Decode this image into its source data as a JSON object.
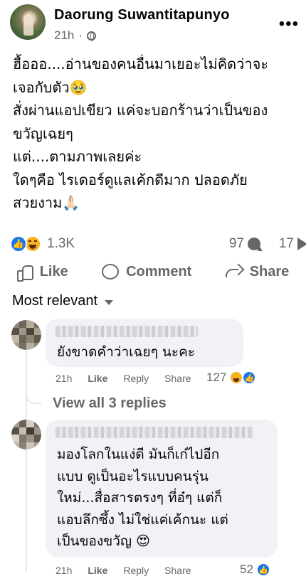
{
  "post": {
    "author": "Daorung Suwantitapunyo",
    "time": "21h",
    "text": "ฮื้อออ....อ่านของคนอื่นมาเยอะไม่คิดว่าจะ\nเจอกับตัว🥹\nสั่งผ่านแอปเขียว แค่จะบอกร้านว่าเป็นของ\nขวัญเฉยๆ\nแต่....ตามภาพเลยค่ะ\nใดๆคือ ไรเดอร์ดูแลเค้กดีมาก ปลอดภัย\nสวยงาม🙏🏻",
    "reaction_count": "1.3K",
    "comment_count": "97",
    "share_count": "17"
  },
  "actions": {
    "like": "Like",
    "comment": "Comment",
    "share": "Share"
  },
  "sort_label": "Most relevant",
  "comments": [
    {
      "text": "ยังขาดคำว่าเฉยๆ นะคะ",
      "time": "21h",
      "like": "Like",
      "reply": "Reply",
      "share": "Share",
      "reaction_count": "127"
    },
    {
      "text": "มองโลกในแง่ดี มันก็เก๋ไปอีก\nแบบ ดูเป็นอะไรแบบคนรุ่น\nใหม่...สื่อสารตรงๆ ที่อ๋ๆ แต่ก็\nแอบลึกซึ้ง ไม่ใช่แค่เค้กนะ แต่\nเป็นของขวัญ 😍",
      "time": "21h",
      "like": "Like",
      "reply": "Reply",
      "share": "Share",
      "reaction_count": "52"
    }
  ],
  "view_replies": "View all 3 replies",
  "colors": {
    "brand_blue": "#1877f2",
    "secondary_text": "#65676b",
    "bubble_bg": "#f0f2f5",
    "haha_yellow": "#f7b125"
  },
  "icons": [
    "globe-icon",
    "more-icon",
    "like-reaction-icon",
    "haha-reaction-icon",
    "comment-bubble-icon",
    "share-arrow-icon",
    "thumb-icon",
    "comment-icon",
    "share-icon",
    "caret-down-icon"
  ]
}
